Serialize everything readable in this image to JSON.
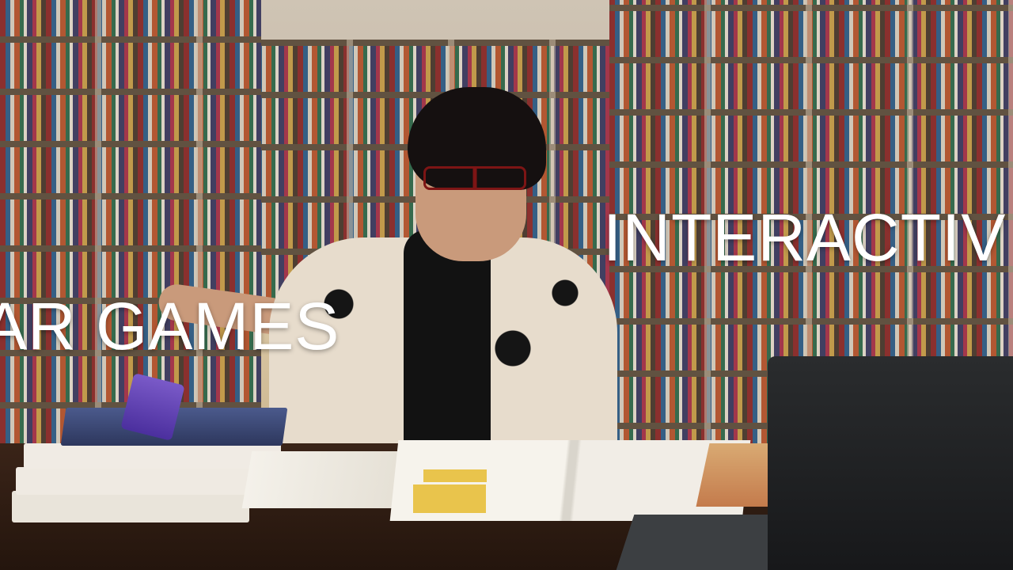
{
  "overlay": {
    "line_right": "INTERACTIV",
    "line_left": "AR GAMES"
  },
  "colors": {
    "text": "#ffffff",
    "glasses": "#7d1515",
    "phone": "#5b3fb4"
  },
  "scene": {
    "setting": "library",
    "icons": [
      "phone-icon",
      "laptop-icon"
    ]
  }
}
